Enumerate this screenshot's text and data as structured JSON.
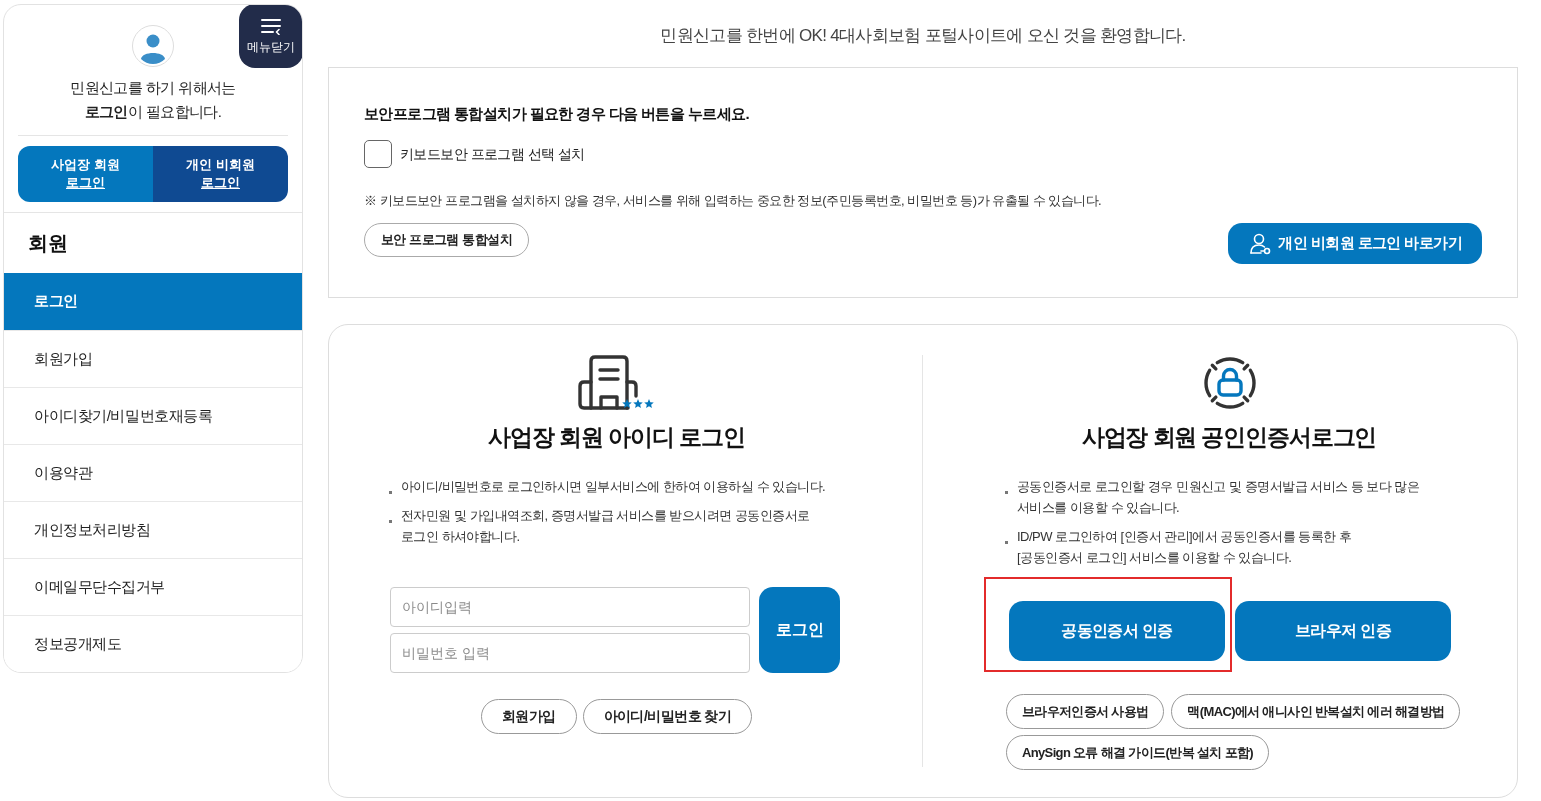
{
  "header": {
    "subtitle": "민원신고를 한번에 OK! 4대사회보험 포털사이트에 오신 것을 환영합니다."
  },
  "sidebar": {
    "menu_button": {
      "label": "메뉴닫기"
    },
    "prompt": [
      "민원신고를 하기 위해서는",
      "**로그인**이 필요합니다."
    ],
    "login_tabs": [
      {
        "lines": [
          "사업장 회원",
          "로그인"
        ],
        "selected": true
      },
      {
        "lines": [
          "개인 비회원",
          "로그인"
        ],
        "selected": false
      }
    ],
    "section_title": "회원",
    "items": [
      {
        "label": "로그인",
        "selected": true
      },
      {
        "label": "회원가입",
        "selected": false
      },
      {
        "label": "아이디찾기/비밀번호재등록",
        "selected": false
      },
      {
        "label": "이용약관",
        "selected": false
      },
      {
        "label": "개인정보처리방침",
        "selected": false
      },
      {
        "label": "이메일무단수집거부",
        "selected": false
      },
      {
        "label": "정보공개제도",
        "selected": false
      }
    ]
  },
  "security": {
    "title": "보안프로그램 통합설치가 필요한 경우 다음 버튼을 누르세요.",
    "checkbox": {
      "label": "키보드보안 프로그램 선택 설치",
      "checked": false
    },
    "notice": "※ 키보드보안 프로그램을 설치하지 않을 경우, 서비스를 위해 입력하는 중요한 정보(주민등록번호, 비밀번호 등)가 유출될 수 있습니다.",
    "install_button": "보안 프로그램 통합설치",
    "guest_button": "개인 비회원 로그인 바로가기"
  },
  "id_login": {
    "title": "사업장 회원 아이디 로그인",
    "bullets": [
      [
        "아이디/비밀번호로 로그인하시면 일부서비스에 한하여 이용하실 수 있습니다."
      ],
      [
        "전자민원 및 가입내역조회, 증명서발급 서비스를 받으시려면 공동인증서로",
        "로그인 하셔야합니다."
      ]
    ],
    "id_field": {
      "placeholder": "아이디입력"
    },
    "password_field": {
      "placeholder": "비밀번호 입력"
    },
    "login_button": "로그인",
    "links": [
      "회원가입",
      "아이디/비밀번호 찾기"
    ]
  },
  "cert_login": {
    "title": "사업장 회원 공인인증서로그인",
    "bullets": [
      [
        "공동인증서로 로그인할 경우 민원신고 및 증명서발급 서비스 등 보다 많은",
        "서비스를 이용할 수 있습니다."
      ],
      [
        "ID/PW 로그인하여 [인증서 관리]에서 공동인증서를 등록한 후",
        "[공동인증서 로그인] 서비스를 이용할 수 있습니다."
      ]
    ],
    "buttons": [
      {
        "label": "공동인증서 인증",
        "highlighted": true
      },
      {
        "label": "브라우저 인증",
        "highlighted": false
      }
    ],
    "links": [
      "브라우저인증서 사용법",
      "맥(MAC)에서 애니사인 반복설치 에러 해결방법",
      "AnySign 오류 해결 가이드(반복 설치 포함)"
    ]
  }
}
